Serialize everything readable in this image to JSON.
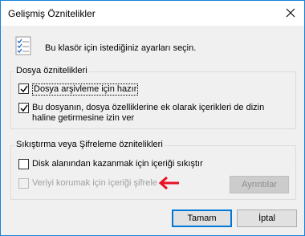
{
  "window": {
    "title": "Gelişmiş Öznitelikler"
  },
  "header": {
    "text": "Bu klasör için istediğiniz ayarları seçin.",
    "icon": "checklist-icon"
  },
  "file_attributes": {
    "group_label": "Dosya öznitelikleri",
    "archive": {
      "label": "Dosya arşivleme için hazır",
      "checked": true
    },
    "index": {
      "label_line1": "Bu dosyanın, dosya özelliklerine ek olarak içerikleri de dizin",
      "label_line2": "haline getirmesine izin ver",
      "checked": true
    }
  },
  "compression": {
    "group_label": "Sıkıştırma veya Şifreleme öznitelikleri",
    "compress": {
      "label": "Disk alanından kazanmak için içeriği sıkıştır",
      "checked": false
    },
    "encrypt": {
      "label": "Veriyi korumak için içeriği şifrele",
      "checked": false,
      "disabled": true
    },
    "details_button": "Ayrıntılar"
  },
  "buttons": {
    "ok": "Tamam",
    "cancel": "İptal"
  },
  "colors": {
    "accent": "#0078d7",
    "annotation_arrow": "#e81123"
  }
}
